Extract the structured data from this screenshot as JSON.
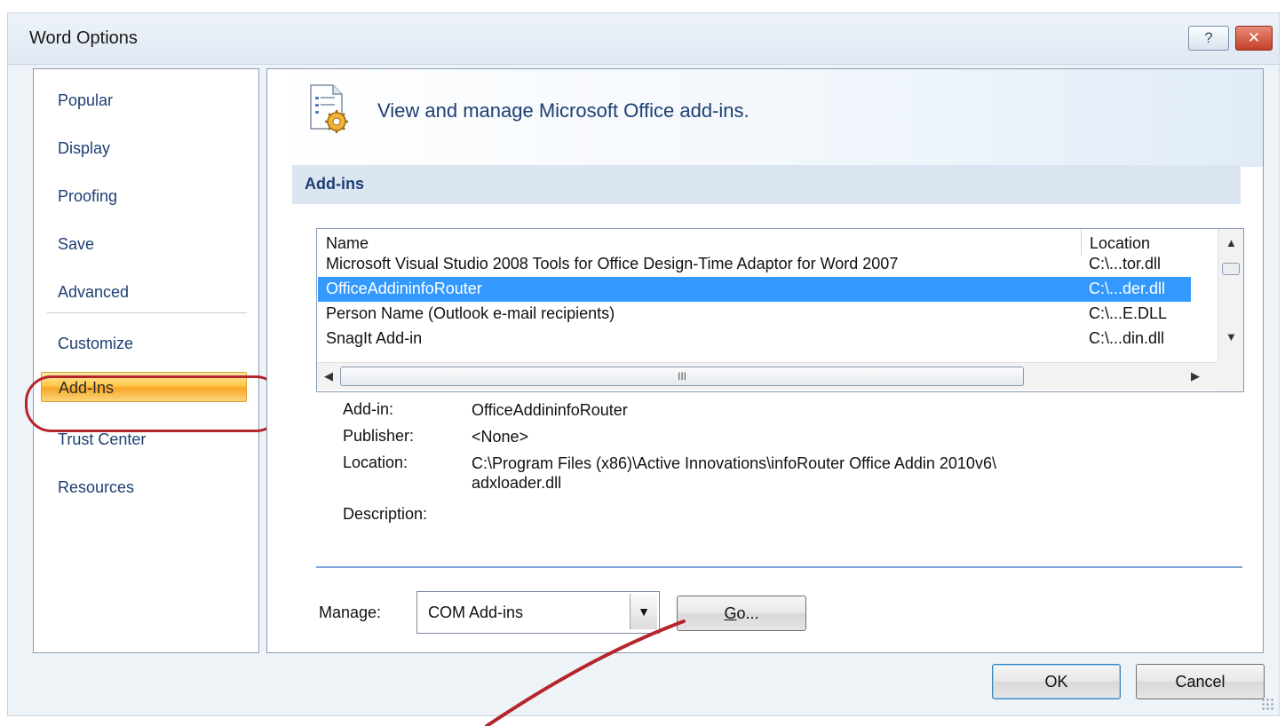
{
  "window": {
    "title": "Word Options",
    "help_glyph": "?",
    "close_glyph": "✕"
  },
  "nav": {
    "items": [
      {
        "label": "Popular"
      },
      {
        "label": "Display"
      },
      {
        "label": "Proofing"
      },
      {
        "label": "Save"
      },
      {
        "label": "Advanced"
      },
      {
        "label": "Customize"
      },
      {
        "label": "Add-Ins"
      },
      {
        "label": "Trust Center"
      },
      {
        "label": "Resources"
      }
    ],
    "selected": "Add-Ins"
  },
  "header": {
    "text": "View and manage Microsoft Office add-ins."
  },
  "section": {
    "title": "Add-ins"
  },
  "addins_list": {
    "columns": {
      "name": "Name",
      "location": "Location"
    },
    "rows": [
      {
        "name": "Microsoft Visual Studio 2008 Tools for Office Design-Time Adaptor for Word 2007",
        "location": "C:\\...tor.dll"
      },
      {
        "name": "OfficeAddininfoRouter",
        "location": "C:\\...der.dll"
      },
      {
        "name": "Person Name (Outlook e-mail recipients)",
        "location": "C:\\...E.DLL"
      },
      {
        "name": "SnagIt Add-in",
        "location": "C:\\...din.dll"
      }
    ],
    "selected_index": 1,
    "hscroll_grip": "III"
  },
  "details": {
    "addin_label": "Add-in:",
    "addin_value": "OfficeAddininfoRouter",
    "publisher_label": "Publisher:",
    "publisher_value": "<None>",
    "location_label": "Location:",
    "location_value_line1": "C:\\Program Files (x86)\\Active Innovations\\infoRouter Office Addin 2010v6\\",
    "location_value_line2": "adxloader.dll",
    "description_label": "Description:"
  },
  "manage": {
    "label": "Manage:",
    "selected": "COM Add-ins",
    "go_prefix": "G",
    "go_rest": "o..."
  },
  "footer": {
    "ok_label": "OK",
    "cancel_label": "Cancel"
  },
  "colors": {
    "selection": "#3399ff",
    "nav_text": "#1d3f73",
    "annotation": "#b5252d"
  }
}
